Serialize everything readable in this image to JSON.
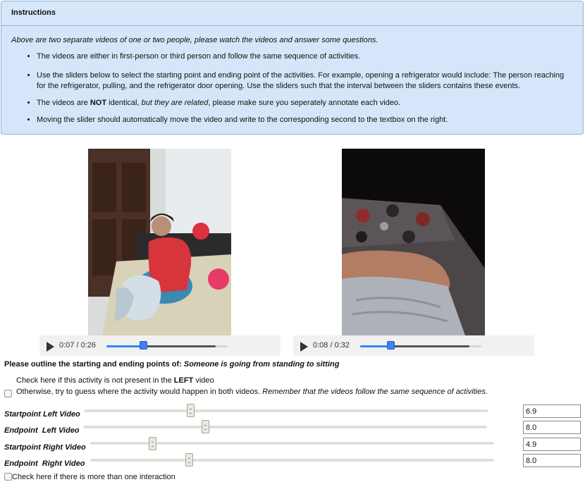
{
  "instructions": {
    "title": "Instructions",
    "intro": "Above are two separate videos of one or two people, please watch the videos and answer some questions.",
    "bullet1": "The videos are either in first-person or third person and follow the same sequence of activities.",
    "bullet2": "Use the sliders below to select the starting point and ending point of the activities. For example, opening a refrigerator would include: The person reaching for the refrigerator, pulling, and the refrigerator door opening. Use the sliders such that the interval between the sliders contains these events.",
    "bullet3_a": "The videos are ",
    "bullet3_b": "NOT",
    "bullet3_c": " identical, ",
    "bullet3_d": "but they are related",
    "bullet3_e": ", please make sure you seperately annotate each video.",
    "bullet4": "Moving the slider should automatically move the video and write to the corresponding second to the textbox on the right."
  },
  "videos": {
    "left": {
      "time": "0:07 / 0:26",
      "progress": 0.3
    },
    "right": {
      "time": "0:08 / 0:32",
      "progress": 0.25
    }
  },
  "question": {
    "prefix": "Please outline the starting and ending points of: ",
    "activity": "Someone is going from standing to sitting"
  },
  "checks": {
    "left_missing_a": "Check here if this activity is not present in the ",
    "left_missing_b": "LEFT",
    "left_missing_c": " video",
    "otherwise_a": "Otherwise, try to guess where the activity would happen in both videos. ",
    "otherwise_b": "Remember that the videos follow the same sequence of activities.",
    "multi": "Check here if there is more than one interaction"
  },
  "sliders": {
    "start_left": {
      "label": "Startpoint Left Video",
      "value": "6.9"
    },
    "end_left": {
      "label": "Endpoint  Left Video",
      "value": "8.0"
    },
    "start_right": {
      "label": "Startpoint Right Video",
      "value": "4.9"
    },
    "end_right": {
      "label": "Endpoint  Right Video",
      "value": "8.0"
    }
  }
}
